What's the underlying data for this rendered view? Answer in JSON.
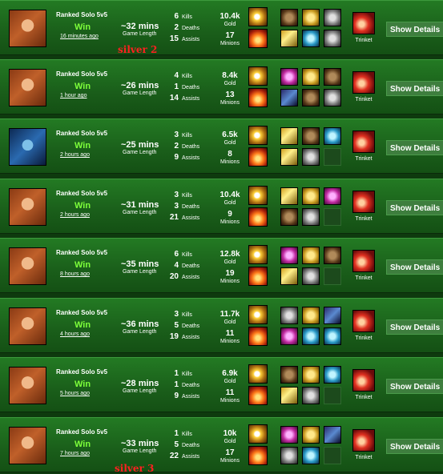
{
  "labels": {
    "game_length": "Game Length",
    "kills": "Kills",
    "deaths": "Deaths",
    "assists": "Assists",
    "gold": "Gold",
    "minions": "Minions",
    "trinket": "Trinket",
    "show_details": "Show Details"
  },
  "matches": [
    {
      "queue": "Ranked Solo 5v5",
      "result": "Win",
      "time_ago": "16 minutes ago",
      "duration": "~32 mins",
      "kills": "6",
      "deaths": "2",
      "assists": "15",
      "gold": "10.4k",
      "minions": "17",
      "note": "silver 2"
    },
    {
      "queue": "Ranked Solo 5v5",
      "result": "Win",
      "time_ago": "1 hour ago",
      "duration": "~26 mins",
      "kills": "4",
      "deaths": "1",
      "assists": "14",
      "gold": "8.4k",
      "minions": "13"
    },
    {
      "queue": "Ranked Solo 5v5",
      "result": "Win",
      "time_ago": "2 hours ago",
      "duration": "~25 mins",
      "kills": "3",
      "deaths": "2",
      "assists": "9",
      "gold": "6.5k",
      "minions": "8"
    },
    {
      "queue": "Ranked Solo 5v5",
      "result": "Win",
      "time_ago": "2 hours ago",
      "duration": "~31 mins",
      "kills": "3",
      "deaths": "3",
      "assists": "21",
      "gold": "10.4k",
      "minions": "9"
    },
    {
      "queue": "Ranked Solo 5v5",
      "result": "Win",
      "time_ago": "8 hours ago",
      "duration": "~35 mins",
      "kills": "6",
      "deaths": "4",
      "assists": "20",
      "gold": "12.8k",
      "minions": "19"
    },
    {
      "queue": "Ranked Solo 5v5",
      "result": "Win",
      "time_ago": "4 hours ago",
      "duration": "~36 mins",
      "kills": "3",
      "deaths": "5",
      "assists": "19",
      "gold": "11.7k",
      "minions": "11"
    },
    {
      "queue": "Ranked Solo 5v5",
      "result": "Win",
      "time_ago": "5 hours ago",
      "duration": "~28 mins",
      "kills": "1",
      "deaths": "1",
      "assists": "9",
      "gold": "6.9k",
      "minions": "11"
    },
    {
      "queue": "Ranked Solo 5v5",
      "result": "Win",
      "time_ago": "7 hours ago",
      "duration": "~33 mins",
      "kills": "1",
      "deaths": "5",
      "assists": "22",
      "gold": "10k",
      "minions": "17",
      "note": "silver 3"
    }
  ],
  "colors": {
    "win_text": "#7dff3a",
    "annotation": "#ff2020",
    "row_bg": "#1f6e1f"
  }
}
